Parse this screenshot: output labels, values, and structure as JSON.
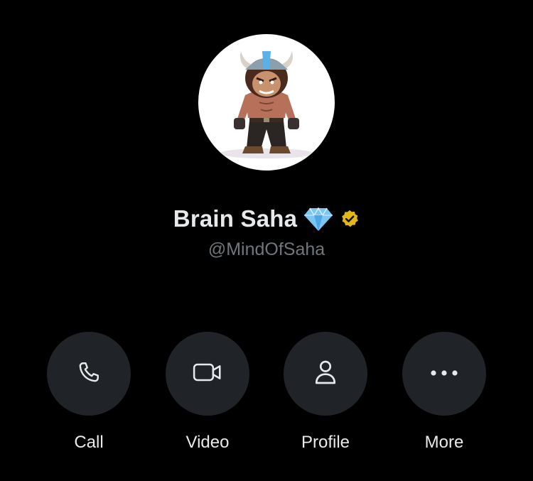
{
  "profile": {
    "display_name": "Brain Saha",
    "handle": "@MindOfSaha",
    "badges": {
      "emoji": "gem-icon",
      "verified": "verified-badge-icon"
    },
    "avatar_icon": "avatar-image"
  },
  "actions": [
    {
      "label": "Call",
      "icon": "phone-icon"
    },
    {
      "label": "Video",
      "icon": "video-camera-icon"
    },
    {
      "label": "Profile",
      "icon": "person-icon"
    },
    {
      "label": "More",
      "icon": "more-dots-icon"
    }
  ],
  "colors": {
    "background": "#000000",
    "button_bg": "#202327",
    "text_primary": "#e7e9ea",
    "text_secondary": "#71767b",
    "icon": "#e7e9ea",
    "verified_gold": "#e2b719"
  }
}
